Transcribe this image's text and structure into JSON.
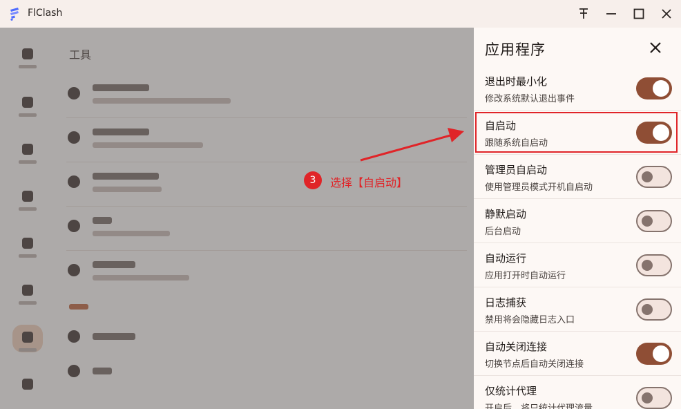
{
  "window": {
    "title": "FlClash",
    "pin_icon": "pin-icon",
    "minimize_icon": "minimize-icon",
    "maximize_icon": "maximize-icon",
    "close_icon": "close-icon"
  },
  "background": {
    "page_title": "工具"
  },
  "drawer": {
    "title": "应用程序",
    "close_icon": "close-icon",
    "settings": [
      {
        "label": "退出时最小化",
        "desc": "修改系统默认退出事件",
        "enabled": true
      },
      {
        "label": "自启动",
        "desc": "跟随系统自启动",
        "enabled": true
      },
      {
        "label": "管理员自启动",
        "desc": "使用管理员模式开机自启动",
        "enabled": false
      },
      {
        "label": "静默启动",
        "desc": "后台启动",
        "enabled": false
      },
      {
        "label": "自动运行",
        "desc": "应用打开时自动运行",
        "enabled": false
      },
      {
        "label": "日志捕获",
        "desc": "禁用将会隐藏日志入口",
        "enabled": false
      },
      {
        "label": "自动关闭连接",
        "desc": "切换节点后自动关闭连接",
        "enabled": true
      },
      {
        "label": "仅统计代理",
        "desc": "开启后，将只统计代理流量",
        "enabled": false
      }
    ]
  },
  "annotation": {
    "step": "3",
    "text": "选择【自启动】",
    "color": "#e02428"
  },
  "colors": {
    "accent": "#8f4e35",
    "toggle_off_bg": "#f3e4de",
    "drawer_bg": "#fdf8f5"
  }
}
